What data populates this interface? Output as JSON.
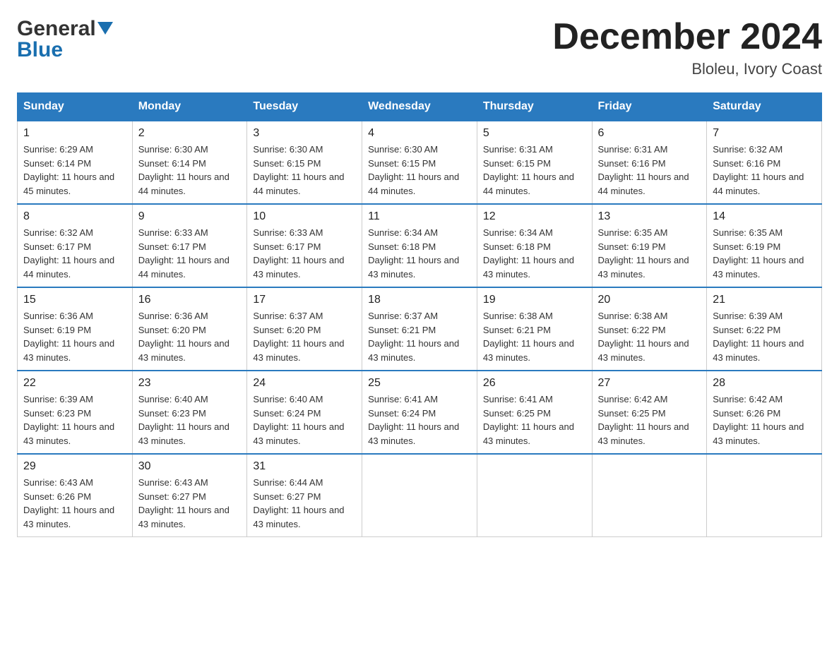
{
  "header": {
    "logo_part1": "General",
    "logo_part2": "Blue",
    "month_title": "December 2024",
    "location": "Bloleu, Ivory Coast"
  },
  "days_of_week": [
    "Sunday",
    "Monday",
    "Tuesday",
    "Wednesday",
    "Thursday",
    "Friday",
    "Saturday"
  ],
  "weeks": [
    [
      {
        "day": "1",
        "sunrise": "6:29 AM",
        "sunset": "6:14 PM",
        "daylight": "11 hours and 45 minutes."
      },
      {
        "day": "2",
        "sunrise": "6:30 AM",
        "sunset": "6:14 PM",
        "daylight": "11 hours and 44 minutes."
      },
      {
        "day": "3",
        "sunrise": "6:30 AM",
        "sunset": "6:15 PM",
        "daylight": "11 hours and 44 minutes."
      },
      {
        "day": "4",
        "sunrise": "6:30 AM",
        "sunset": "6:15 PM",
        "daylight": "11 hours and 44 minutes."
      },
      {
        "day": "5",
        "sunrise": "6:31 AM",
        "sunset": "6:15 PM",
        "daylight": "11 hours and 44 minutes."
      },
      {
        "day": "6",
        "sunrise": "6:31 AM",
        "sunset": "6:16 PM",
        "daylight": "11 hours and 44 minutes."
      },
      {
        "day": "7",
        "sunrise": "6:32 AM",
        "sunset": "6:16 PM",
        "daylight": "11 hours and 44 minutes."
      }
    ],
    [
      {
        "day": "8",
        "sunrise": "6:32 AM",
        "sunset": "6:17 PM",
        "daylight": "11 hours and 44 minutes."
      },
      {
        "day": "9",
        "sunrise": "6:33 AM",
        "sunset": "6:17 PM",
        "daylight": "11 hours and 44 minutes."
      },
      {
        "day": "10",
        "sunrise": "6:33 AM",
        "sunset": "6:17 PM",
        "daylight": "11 hours and 43 minutes."
      },
      {
        "day": "11",
        "sunrise": "6:34 AM",
        "sunset": "6:18 PM",
        "daylight": "11 hours and 43 minutes."
      },
      {
        "day": "12",
        "sunrise": "6:34 AM",
        "sunset": "6:18 PM",
        "daylight": "11 hours and 43 minutes."
      },
      {
        "day": "13",
        "sunrise": "6:35 AM",
        "sunset": "6:19 PM",
        "daylight": "11 hours and 43 minutes."
      },
      {
        "day": "14",
        "sunrise": "6:35 AM",
        "sunset": "6:19 PM",
        "daylight": "11 hours and 43 minutes."
      }
    ],
    [
      {
        "day": "15",
        "sunrise": "6:36 AM",
        "sunset": "6:19 PM",
        "daylight": "11 hours and 43 minutes."
      },
      {
        "day": "16",
        "sunrise": "6:36 AM",
        "sunset": "6:20 PM",
        "daylight": "11 hours and 43 minutes."
      },
      {
        "day": "17",
        "sunrise": "6:37 AM",
        "sunset": "6:20 PM",
        "daylight": "11 hours and 43 minutes."
      },
      {
        "day": "18",
        "sunrise": "6:37 AM",
        "sunset": "6:21 PM",
        "daylight": "11 hours and 43 minutes."
      },
      {
        "day": "19",
        "sunrise": "6:38 AM",
        "sunset": "6:21 PM",
        "daylight": "11 hours and 43 minutes."
      },
      {
        "day": "20",
        "sunrise": "6:38 AM",
        "sunset": "6:22 PM",
        "daylight": "11 hours and 43 minutes."
      },
      {
        "day": "21",
        "sunrise": "6:39 AM",
        "sunset": "6:22 PM",
        "daylight": "11 hours and 43 minutes."
      }
    ],
    [
      {
        "day": "22",
        "sunrise": "6:39 AM",
        "sunset": "6:23 PM",
        "daylight": "11 hours and 43 minutes."
      },
      {
        "day": "23",
        "sunrise": "6:40 AM",
        "sunset": "6:23 PM",
        "daylight": "11 hours and 43 minutes."
      },
      {
        "day": "24",
        "sunrise": "6:40 AM",
        "sunset": "6:24 PM",
        "daylight": "11 hours and 43 minutes."
      },
      {
        "day": "25",
        "sunrise": "6:41 AM",
        "sunset": "6:24 PM",
        "daylight": "11 hours and 43 minutes."
      },
      {
        "day": "26",
        "sunrise": "6:41 AM",
        "sunset": "6:25 PM",
        "daylight": "11 hours and 43 minutes."
      },
      {
        "day": "27",
        "sunrise": "6:42 AM",
        "sunset": "6:25 PM",
        "daylight": "11 hours and 43 minutes."
      },
      {
        "day": "28",
        "sunrise": "6:42 AM",
        "sunset": "6:26 PM",
        "daylight": "11 hours and 43 minutes."
      }
    ],
    [
      {
        "day": "29",
        "sunrise": "6:43 AM",
        "sunset": "6:26 PM",
        "daylight": "11 hours and 43 minutes."
      },
      {
        "day": "30",
        "sunrise": "6:43 AM",
        "sunset": "6:27 PM",
        "daylight": "11 hours and 43 minutes."
      },
      {
        "day": "31",
        "sunrise": "6:44 AM",
        "sunset": "6:27 PM",
        "daylight": "11 hours and 43 minutes."
      },
      null,
      null,
      null,
      null
    ]
  ],
  "labels": {
    "sunrise": "Sunrise:",
    "sunset": "Sunset:",
    "daylight": "Daylight:"
  }
}
